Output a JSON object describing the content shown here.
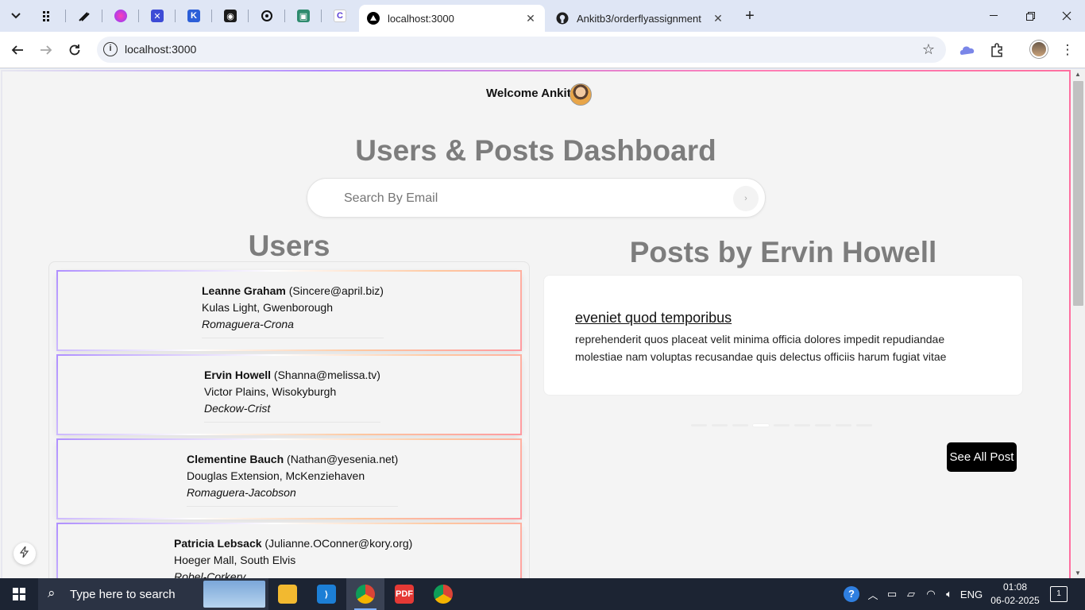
{
  "browser": {
    "tabs": [
      {
        "title": "localhost:3000",
        "active": true
      },
      {
        "title": "Ankitb3/orderflyassignment",
        "active": false
      }
    ],
    "address": "localhost:3000"
  },
  "page": {
    "welcome": "Welcome Ankit",
    "title": "Users & Posts Dashboard",
    "search_placeholder": "Search By Email",
    "users_heading": "Users",
    "users": [
      {
        "name": "Leanne Graham",
        "email": "(Sincere@april.biz)",
        "address": "Kulas Light, Gwenborough",
        "company": "Romaguera-Crona"
      },
      {
        "name": "Ervin Howell",
        "email": "(Shanna@melissa.tv)",
        "address": "Victor Plains, Wisokyburgh",
        "company": "Deckow-Crist"
      },
      {
        "name": "Clementine Bauch",
        "email": "(Nathan@yesenia.net)",
        "address": "Douglas Extension, McKenziehaven",
        "company": "Romaguera-Jacobson"
      },
      {
        "name": "Patricia Lebsack",
        "email": "(Julianne.OConner@kory.org)",
        "address": "Hoeger Mall, South Elvis",
        "company": "Robel-Corkery"
      }
    ],
    "posts_heading": "Posts by Ervin Howell",
    "post": {
      "title": "eveniet quod temporibus",
      "body": "reprehenderit quos placeat velit minima officia dolores impedit repudiandae molestiae nam voluptas recusandae quis delectus officiis harum fugiat vitae"
    },
    "carousel_active_index": 3,
    "see_all_label": "See All Post"
  },
  "taskbar": {
    "search_text": "Type here to search",
    "language": "ENG",
    "time": "01:08",
    "date": "06-02-2025",
    "notification_count": "1"
  },
  "colors": {
    "accent_purple": "#b090ff",
    "accent_pink": "#ff7eb6",
    "button_black": "#000000",
    "heading_gray": "#7d7d7d"
  }
}
